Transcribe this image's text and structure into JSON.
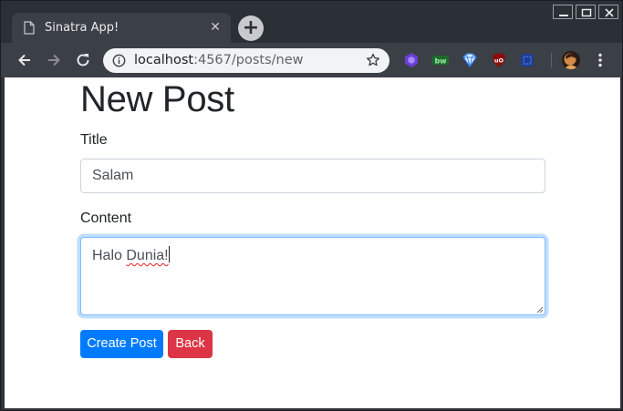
{
  "browser": {
    "tab": {
      "title": "Sinatra App!",
      "close_glyph": "✕",
      "favicon": "document-icon"
    },
    "new_tab_glyph": "+",
    "address": {
      "host": "localhost",
      "rest": ":4567/posts/new"
    },
    "extensions": [
      "hexagon-extension-icon",
      "bw-extension-icon",
      "gem-extension-icon",
      "ublock-extension-icon",
      "square-extension-icon"
    ],
    "colors": {
      "chrome_dark": "#2b2f36",
      "chrome_toolbar": "#3b3f46",
      "omnibox": "#f1f3f4"
    }
  },
  "page": {
    "heading": "New Post",
    "form": {
      "title_label": "Title",
      "title_value": "Salam",
      "content_label": "Content",
      "content_value_word1": "Halo",
      "content_value_word2": "Dunia!",
      "create_button": "Create Post",
      "back_button": "Back"
    },
    "colors": {
      "primary": "#007bff",
      "danger": "#dc3545",
      "focus_border": "#80bdff"
    }
  }
}
